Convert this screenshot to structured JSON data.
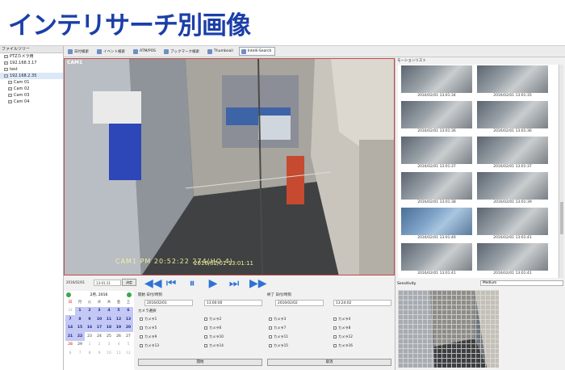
{
  "page_heading": "インテリサーチ別画像",
  "tree": {
    "title": "ファイルツリー",
    "items": [
      {
        "label": "PTZカメラ用",
        "indent": 1
      },
      {
        "label": "192.168.3.17",
        "indent": 1
      },
      {
        "label": "test",
        "indent": 1
      },
      {
        "label": "192.168.2.35",
        "indent": 1,
        "selected": true
      },
      {
        "label": "Cam 01",
        "indent": 2
      },
      {
        "label": "Cam 02",
        "indent": 2
      },
      {
        "label": "Cam 03",
        "indent": 2
      },
      {
        "label": "Cam 04",
        "indent": 2
      }
    ]
  },
  "toolbar": {
    "tabs": [
      "日付検索",
      "イベント検索",
      "ATM/POS",
      "ブックマーク検索",
      "Thumbnail",
      "Intelli-Search"
    ],
    "active_tab": "Intelli-Search"
  },
  "video": {
    "camera_label": "CAM1",
    "osd_time": "CAM1  PM 20:52:22 274(HO 4)",
    "osd_date": "2016/02/01 13:01:11"
  },
  "playback": {
    "date": "2016/02/01",
    "time": "13:01:11",
    "apply_label": "決定"
  },
  "calendar": {
    "month": "2月, 2016",
    "weekdays": [
      "日",
      "月",
      "火",
      "水",
      "木",
      "金",
      "土"
    ],
    "rows": [
      [
        "31",
        "1",
        "2",
        "3",
        "4",
        "5",
        "6"
      ],
      [
        "7",
        "8",
        "9",
        "10",
        "11",
        "12",
        "13"
      ],
      [
        "14",
        "15",
        "16",
        "17",
        "18",
        "19",
        "20"
      ],
      [
        "21",
        "22",
        "23",
        "24",
        "25",
        "26",
        "27"
      ],
      [
        "28",
        "29",
        "1",
        "2",
        "3",
        "4",
        "5"
      ],
      [
        "6",
        "7",
        "8",
        "9",
        "10",
        "11",
        "12"
      ]
    ]
  },
  "search": {
    "start_label": "開始 日付/時刻",
    "end_label": "終了 日付/時刻",
    "start_date": "2016/02/01",
    "start_time": "13:00:00",
    "end_date": "2016/02/02",
    "end_time": "13:24:02",
    "camera_select_label": "カメラ選択",
    "cameras": [
      "カメラ1",
      "カメラ2",
      "カメラ3",
      "カメラ4",
      "カメラ5",
      "カメラ6",
      "カメラ7",
      "カメラ8",
      "カメラ9",
      "カメラ10",
      "カメラ11",
      "カメラ12",
      "カメラ13",
      "カメラ14",
      "カメラ15",
      "カメラ16"
    ],
    "start_button": "開始",
    "cancel_button": "取消"
  },
  "motion_list": {
    "title": "モーションリスト",
    "thumbnails": [
      "2016/02/01 13:01:34",
      "2016/02/01 13:01:35",
      "2016/02/01 13:01:36",
      "2016/02/01 13:01:36",
      "2016/02/01 13:01:37",
      "2016/02/01 13:01:37",
      "2016/02/01 13:01:38",
      "2016/02/01 13:01:39",
      "2016/02/01 13:01:40",
      "2016/02/01 13:01:41",
      "2016/02/01 13:01:41",
      "2016/02/01 13:01:41"
    ],
    "selected_index": 8
  },
  "sensitivity": {
    "label": "Sensitivity",
    "value": "Medium"
  }
}
